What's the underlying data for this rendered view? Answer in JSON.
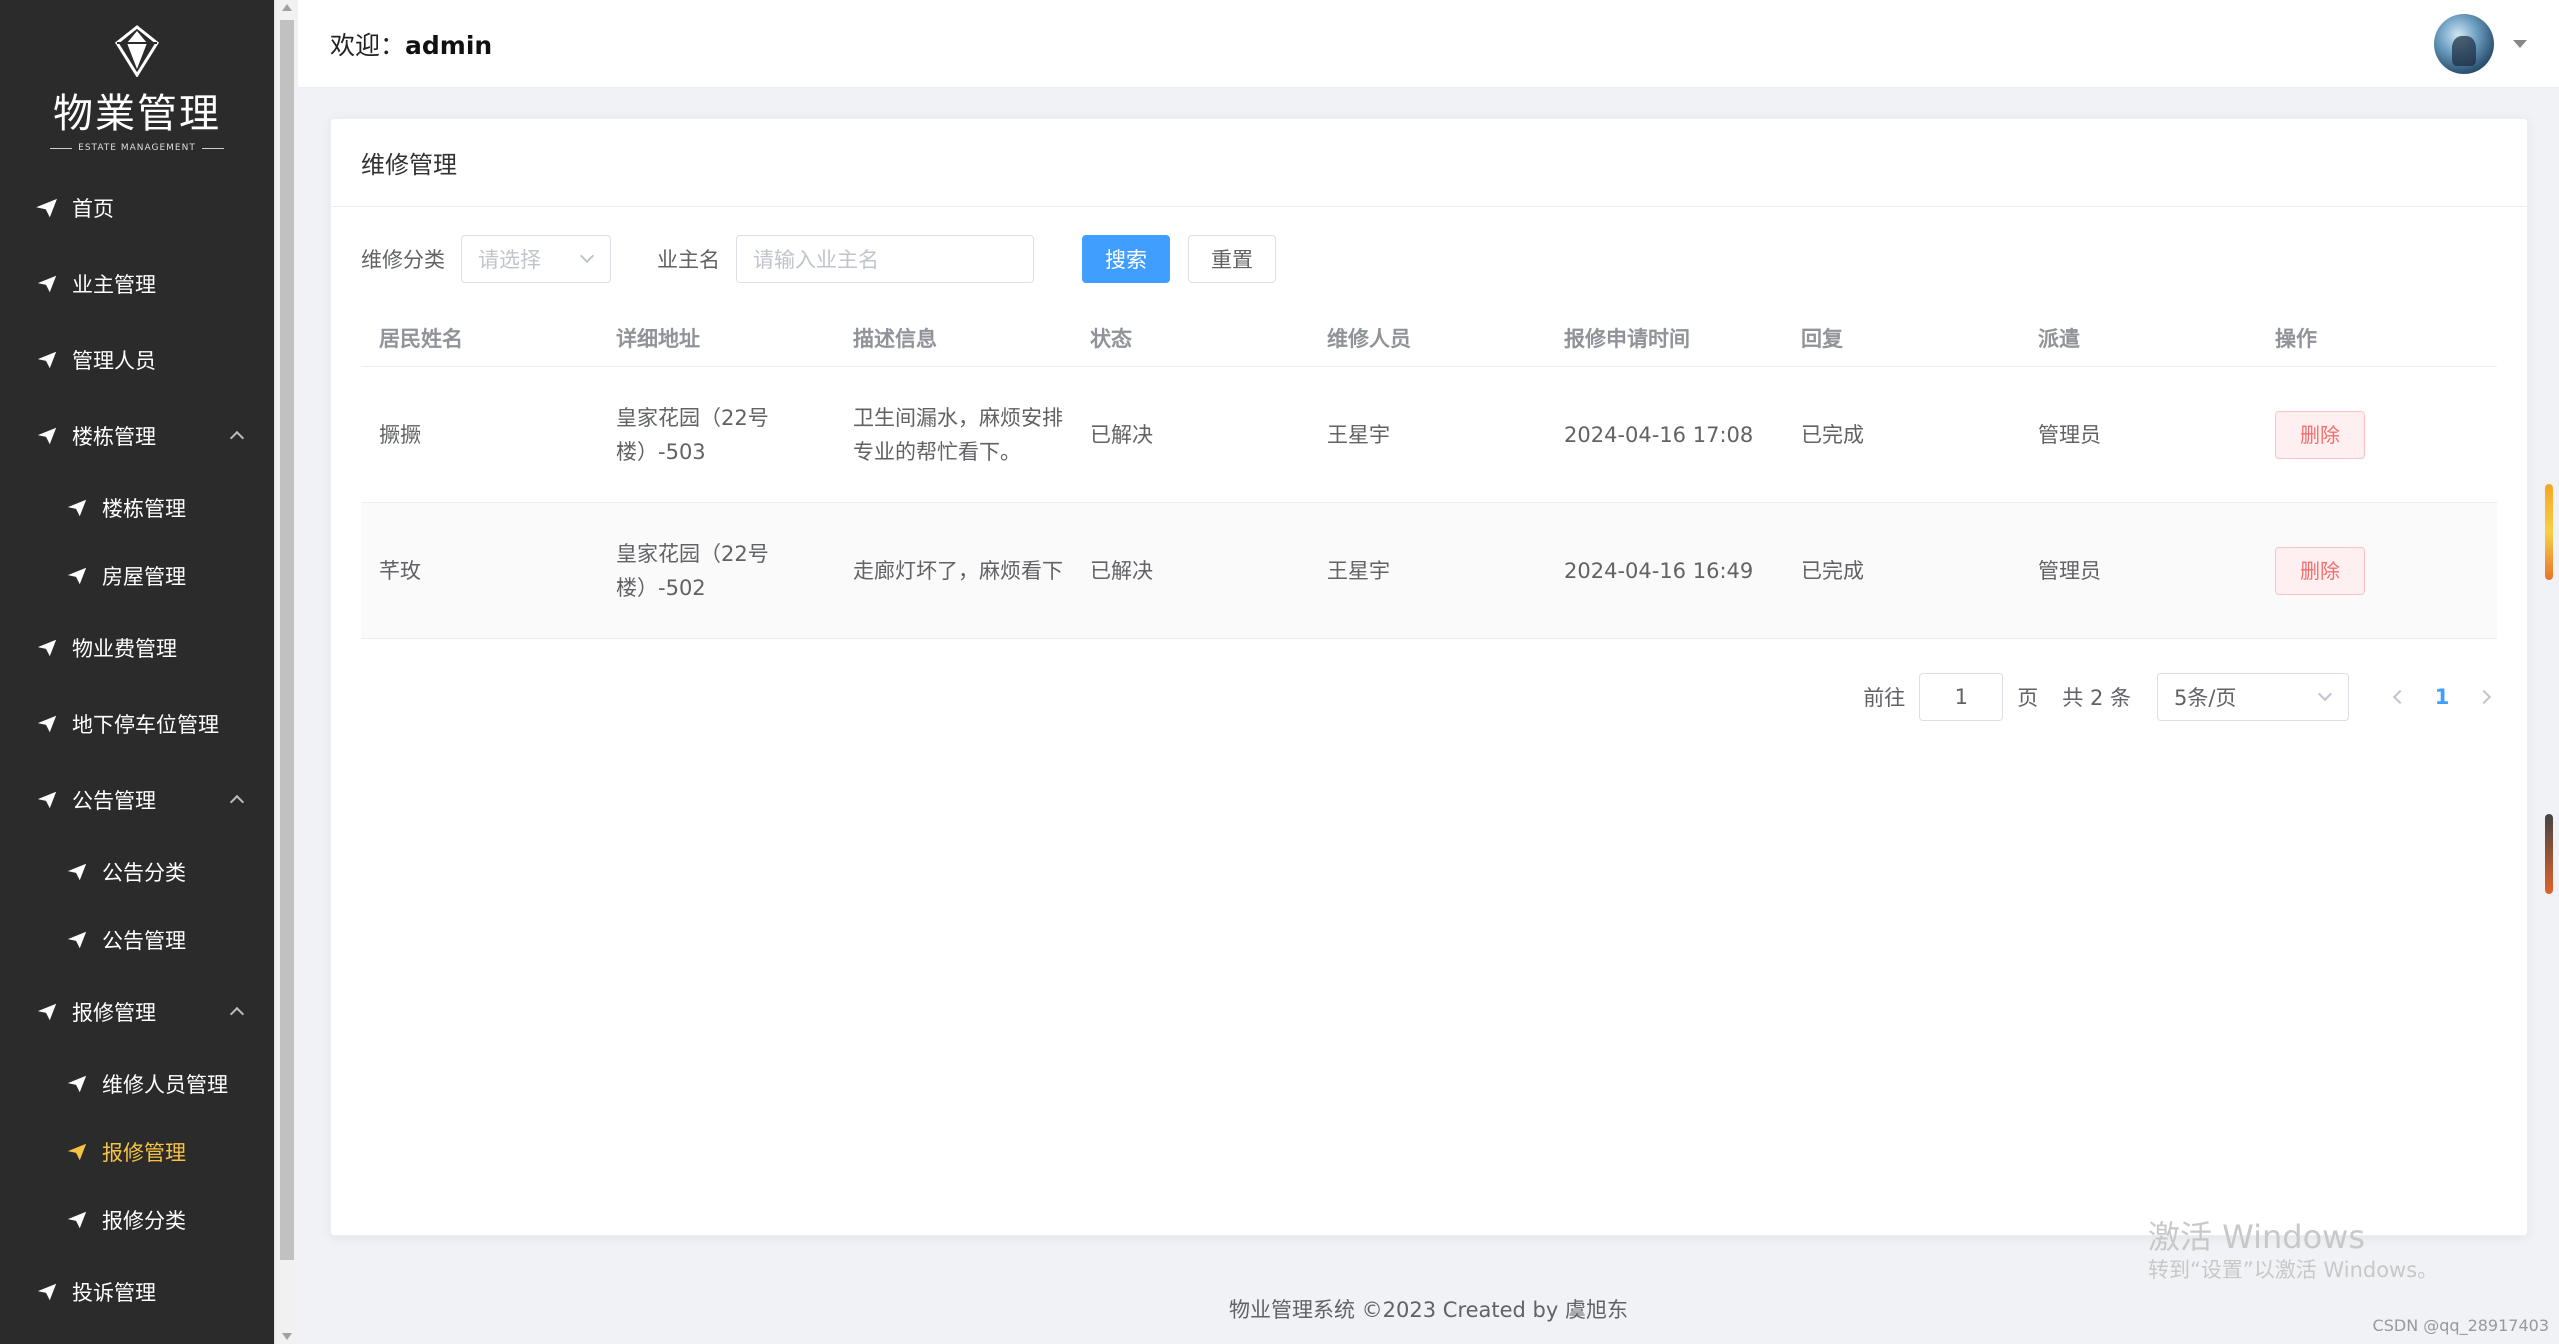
{
  "sidebar": {
    "logo_title": "物業管理",
    "logo_sub": "ESTATE MANAGEMENT",
    "items": [
      {
        "label": "首页"
      },
      {
        "label": "业主管理"
      },
      {
        "label": "管理人员"
      },
      {
        "label": "楼栋管理"
      },
      {
        "label": "楼栋管理"
      },
      {
        "label": "房屋管理"
      },
      {
        "label": "物业费管理"
      },
      {
        "label": "地下停车位管理"
      },
      {
        "label": "公告管理"
      },
      {
        "label": "公告分类"
      },
      {
        "label": "公告管理"
      },
      {
        "label": "报修管理"
      },
      {
        "label": "维修人员管理"
      },
      {
        "label": "报修管理"
      },
      {
        "label": "报修分类"
      },
      {
        "label": "投诉管理"
      }
    ]
  },
  "header": {
    "welcome_prefix": "欢迎：",
    "username": "admin"
  },
  "card": {
    "title": "维修管理"
  },
  "filters": {
    "category_label": "维修分类",
    "category_placeholder": "请选择",
    "owner_label": "业主名",
    "owner_placeholder": "请输入业主名",
    "search_label": "搜索",
    "reset_label": "重置"
  },
  "table": {
    "headers": [
      "居民姓名",
      "详细地址",
      "描述信息",
      "状态",
      "维修人员",
      "报修申请时间",
      "回复",
      "派遣",
      "操作"
    ],
    "rows": [
      {
        "name": "撅撅",
        "address": "皇家花园（22号楼）-503",
        "description": "卫生间漏水，麻烦安排专业的帮忙看下。",
        "status": "已解决",
        "repairer": "王星宇",
        "time": "2024-04-16 17:08",
        "reply": "已完成",
        "dispatch": "管理员",
        "action": "删除"
      },
      {
        "name": "芊玫",
        "address": "皇家花园（22号楼）-502",
        "description": "走廊灯坏了，麻烦看下",
        "status": "已解决",
        "repairer": "王星宇",
        "time": "2024-04-16 16:49",
        "reply": "已完成",
        "dispatch": "管理员",
        "action": "删除"
      }
    ]
  },
  "pagination": {
    "goto_label": "前往",
    "page_value": "1",
    "page_suffix": "页",
    "total_text": "共 2 条",
    "page_size": "5条/页",
    "current_page": "1"
  },
  "footer": {
    "text": "物业管理系统 ©2023 Created by 虞旭东"
  },
  "watermark": {
    "line1": "激活 Windows",
    "line2": "转到“设置”以激活 Windows。",
    "csdn": "CSDN @qq_28917403"
  },
  "colors": {
    "sidebar_bg": "#2b2b2b",
    "active_menu": "#f6c343",
    "primary": "#409eff",
    "danger": "#f56c6c"
  }
}
